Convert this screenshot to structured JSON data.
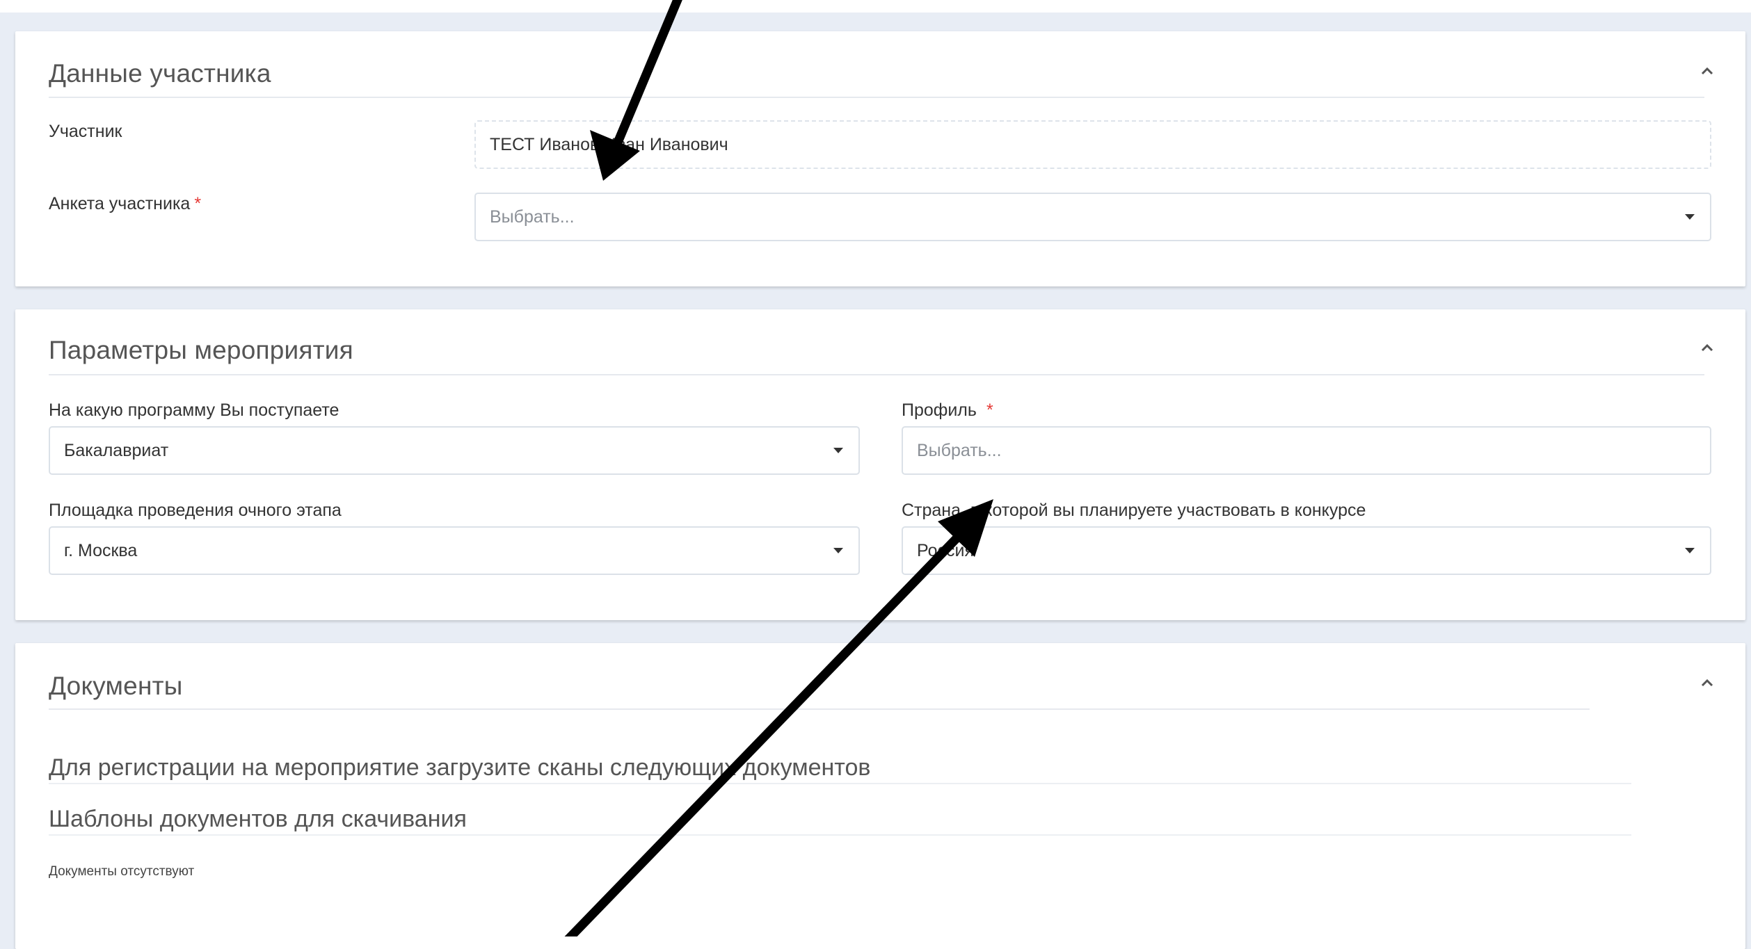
{
  "participant_section": {
    "title": "Данные участника",
    "participant_label": "Участник",
    "participant_value": "ТЕСТ Иванов Иван Иванович",
    "profile_label": "Анкета участника",
    "required_mark": "*",
    "profile_placeholder": "Выбрать..."
  },
  "event_section": {
    "title": "Параметры мероприятия",
    "program_label": "На какую программу Вы поступаете",
    "program_value": "Бакалавриат",
    "profile_label": "Профиль",
    "required_mark": "*",
    "profile_placeholder": "Выбрать...",
    "venue_label": "Площадка проведения очного этапа",
    "venue_value": "г. Москва",
    "country_label": "Страна, в которой вы планируете участвовать в конкурсе",
    "country_value": "Россия"
  },
  "documents_section": {
    "title": "Документы",
    "upload_heading": "Для регистрации на мероприятие загрузите сканы следующих документов",
    "templates_heading": "Шаблоны документов для скачивания",
    "empty_text": "Документы отсутствуют"
  },
  "icons": {
    "collapse": "chevron-up-icon",
    "dropdown": "caret-down-icon",
    "annotation": "arrow-icon"
  },
  "colors": {
    "background": "#e8edf5",
    "required": "#e53935",
    "annotation_arrow": "#000000"
  }
}
